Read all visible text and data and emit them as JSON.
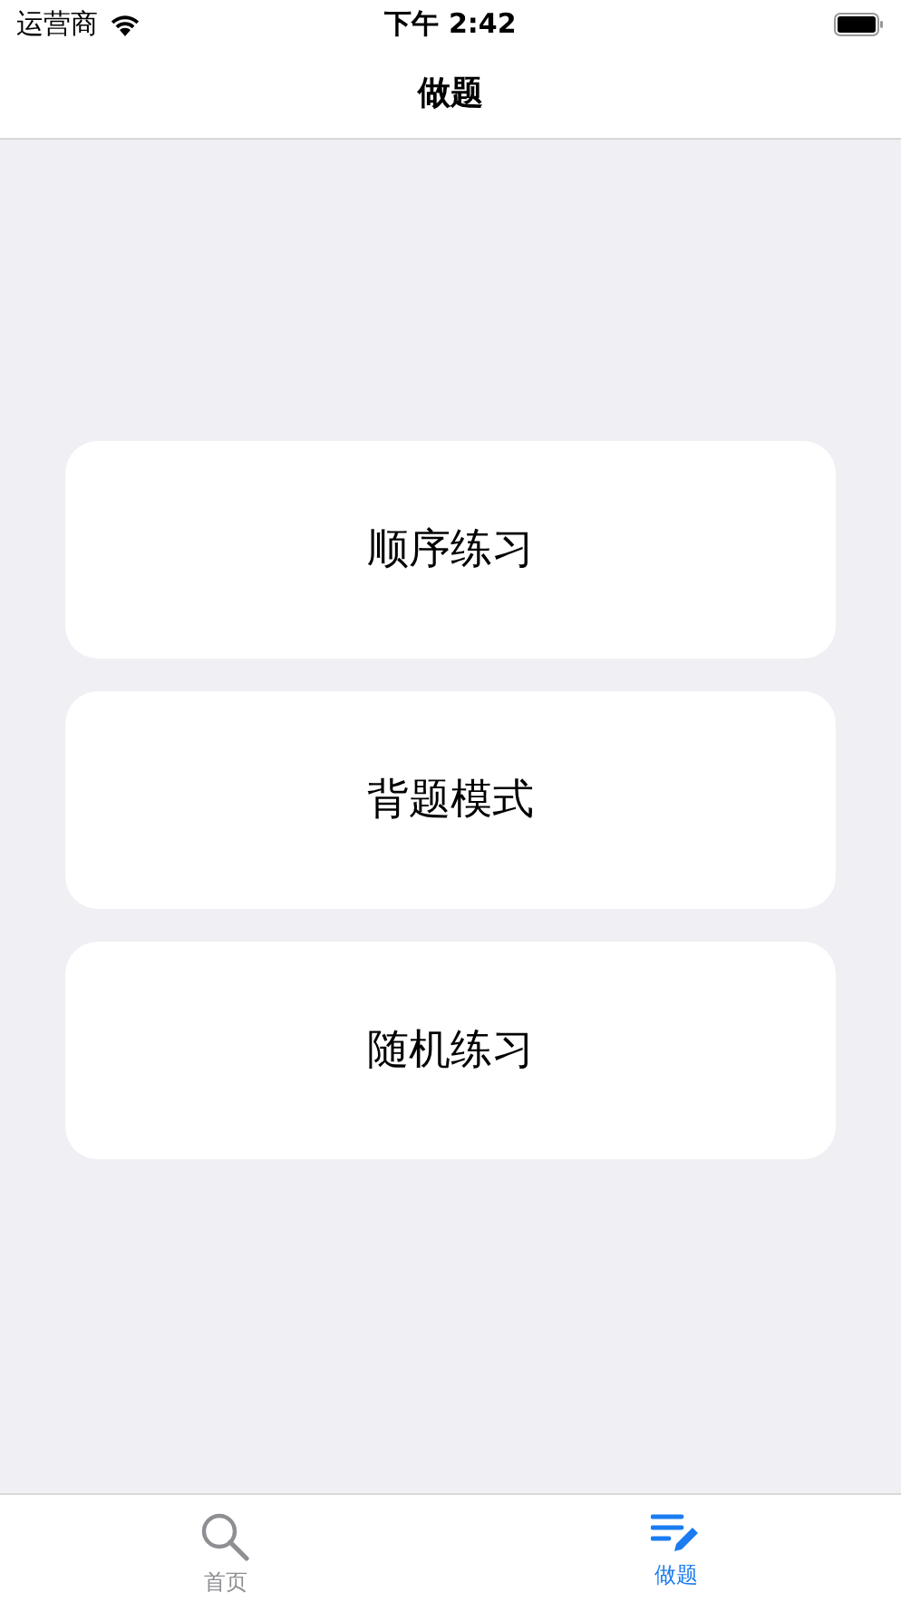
{
  "status_bar": {
    "carrier": "运营商",
    "time": "下午 2:42"
  },
  "nav_bar": {
    "title": "做题"
  },
  "options": [
    {
      "label": "顺序练习"
    },
    {
      "label": "背题模式"
    },
    {
      "label": "随机练习"
    }
  ],
  "tab_bar": [
    {
      "label": "首页",
      "selected": false
    },
    {
      "label": "做题",
      "selected": true
    }
  ]
}
